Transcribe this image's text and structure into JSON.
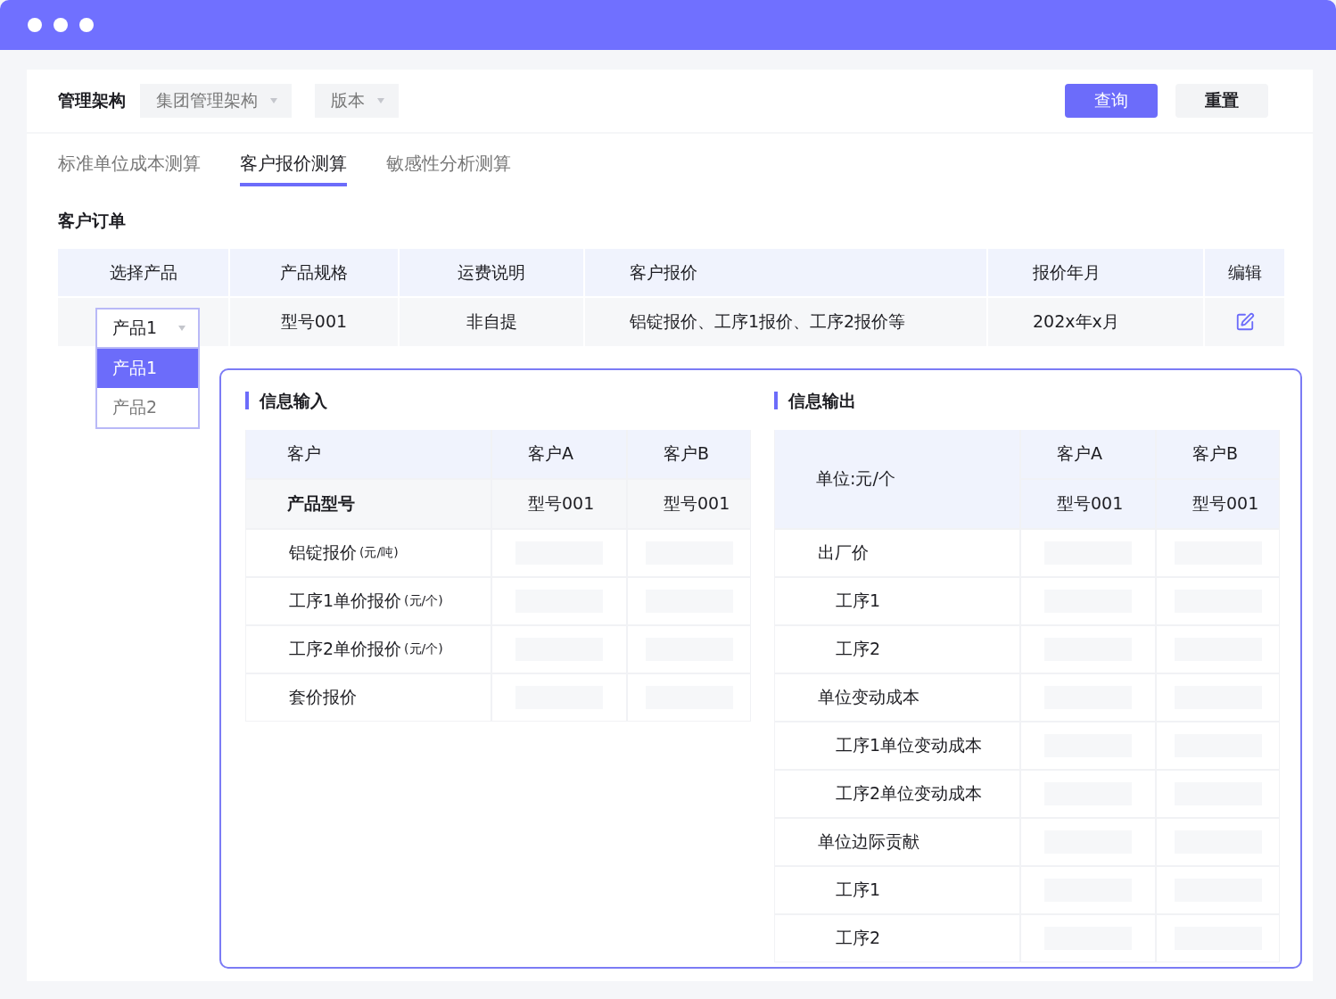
{
  "filters": {
    "label": "管理架构",
    "selects": [
      {
        "value": "集团管理架构"
      },
      {
        "value": "版本"
      }
    ],
    "buttons": [
      {
        "label": "查询",
        "kind": "primary"
      },
      {
        "label": "重置",
        "kind": "secondary"
      }
    ]
  },
  "tabs": [
    {
      "label": "标准单位成本测算",
      "selected": false
    },
    {
      "label": "客户报价测算",
      "selected": true
    },
    {
      "label": "敏感性分析测算",
      "selected": false
    }
  ],
  "order": {
    "title": "客户订单",
    "columns": [
      "选择产品",
      "产品规格",
      "运费说明",
      "客户报价",
      "报价年月",
      "编辑"
    ],
    "rows": [
      {
        "product": "产品1",
        "options": [
          {
            "label": "产品1",
            "selected": true
          },
          {
            "label": "产品2",
            "selected": false
          }
        ],
        "spec": "型号001",
        "freight": "非自提",
        "quote": "铝锭报价、工序1报价、工序2报价等",
        "month": "202x年x月"
      }
    ]
  },
  "input": {
    "title": "信息输入",
    "header": [
      "客户",
      "客户A",
      "客户B"
    ],
    "model_row": [
      "产品型号",
      "型号001",
      "型号001"
    ],
    "rows": [
      {
        "label": "铝锭报价",
        "unit": "(元/吨)"
      },
      {
        "label": "工序1单价报价",
        "unit": "(元/个)"
      },
      {
        "label": "工序2单价报价",
        "unit": "(元/个)"
      },
      {
        "label": "套价报价"
      }
    ]
  },
  "output": {
    "title": "信息输出",
    "unit_label": "单位:元/个",
    "customers": [
      "客户A",
      "客户B"
    ],
    "models": [
      "型号001",
      "型号001"
    ],
    "rows": [
      {
        "label": "出厂价",
        "children": [
          {
            "label": "工序1"
          },
          {
            "label": "工序2"
          }
        ]
      },
      {
        "label": "单位变动成本",
        "children": [
          {
            "label": "工序1单位变动成本"
          },
          {
            "label": "工序2单位变动成本"
          }
        ]
      },
      {
        "label": "单位边际贡献",
        "children": [
          {
            "label": "工序1"
          },
          {
            "label": "工序2"
          }
        ]
      }
    ]
  }
}
